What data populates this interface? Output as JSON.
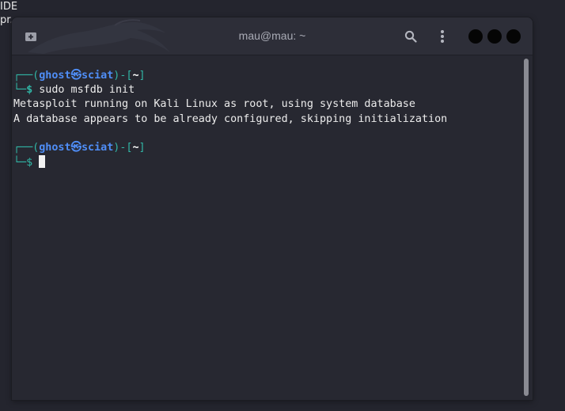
{
  "desktop": {
    "label_line1": "IDE",
    "label_line2": "pr..."
  },
  "window": {
    "title": "mau@mau: ~"
  },
  "icons": {
    "new_tab": "new-tab-icon",
    "search": "search-icon",
    "menu": "kebab-menu-icon",
    "minimize": "minimize-circle",
    "maximize": "maximize-circle",
    "close": "close-circle",
    "background": "kali-dragon-icon"
  },
  "terminal": {
    "prompt1": {
      "frame_open": "┌──(",
      "user": "ghost",
      "symbol": "㉿",
      "host": "sciat",
      "frame_mid": ")-[",
      "dir": "~",
      "frame_close": "]",
      "arrow": "└─$",
      "command": " sudo msfdb init"
    },
    "output1": "Metasploit running on Kali Linux as root, using system database",
    "output2": "A database appears to be already configured, skipping initialization",
    "prompt2": {
      "frame_open": "┌──(",
      "user": "ghost",
      "symbol": "㉿",
      "host": "sciat",
      "frame_mid": ")-[",
      "dir": "~",
      "frame_close": "]",
      "arrow": "└─$",
      "command": " "
    }
  },
  "colors": {
    "frame": "#31b6a6",
    "user": "#4f8ef7",
    "background": "#272831"
  }
}
